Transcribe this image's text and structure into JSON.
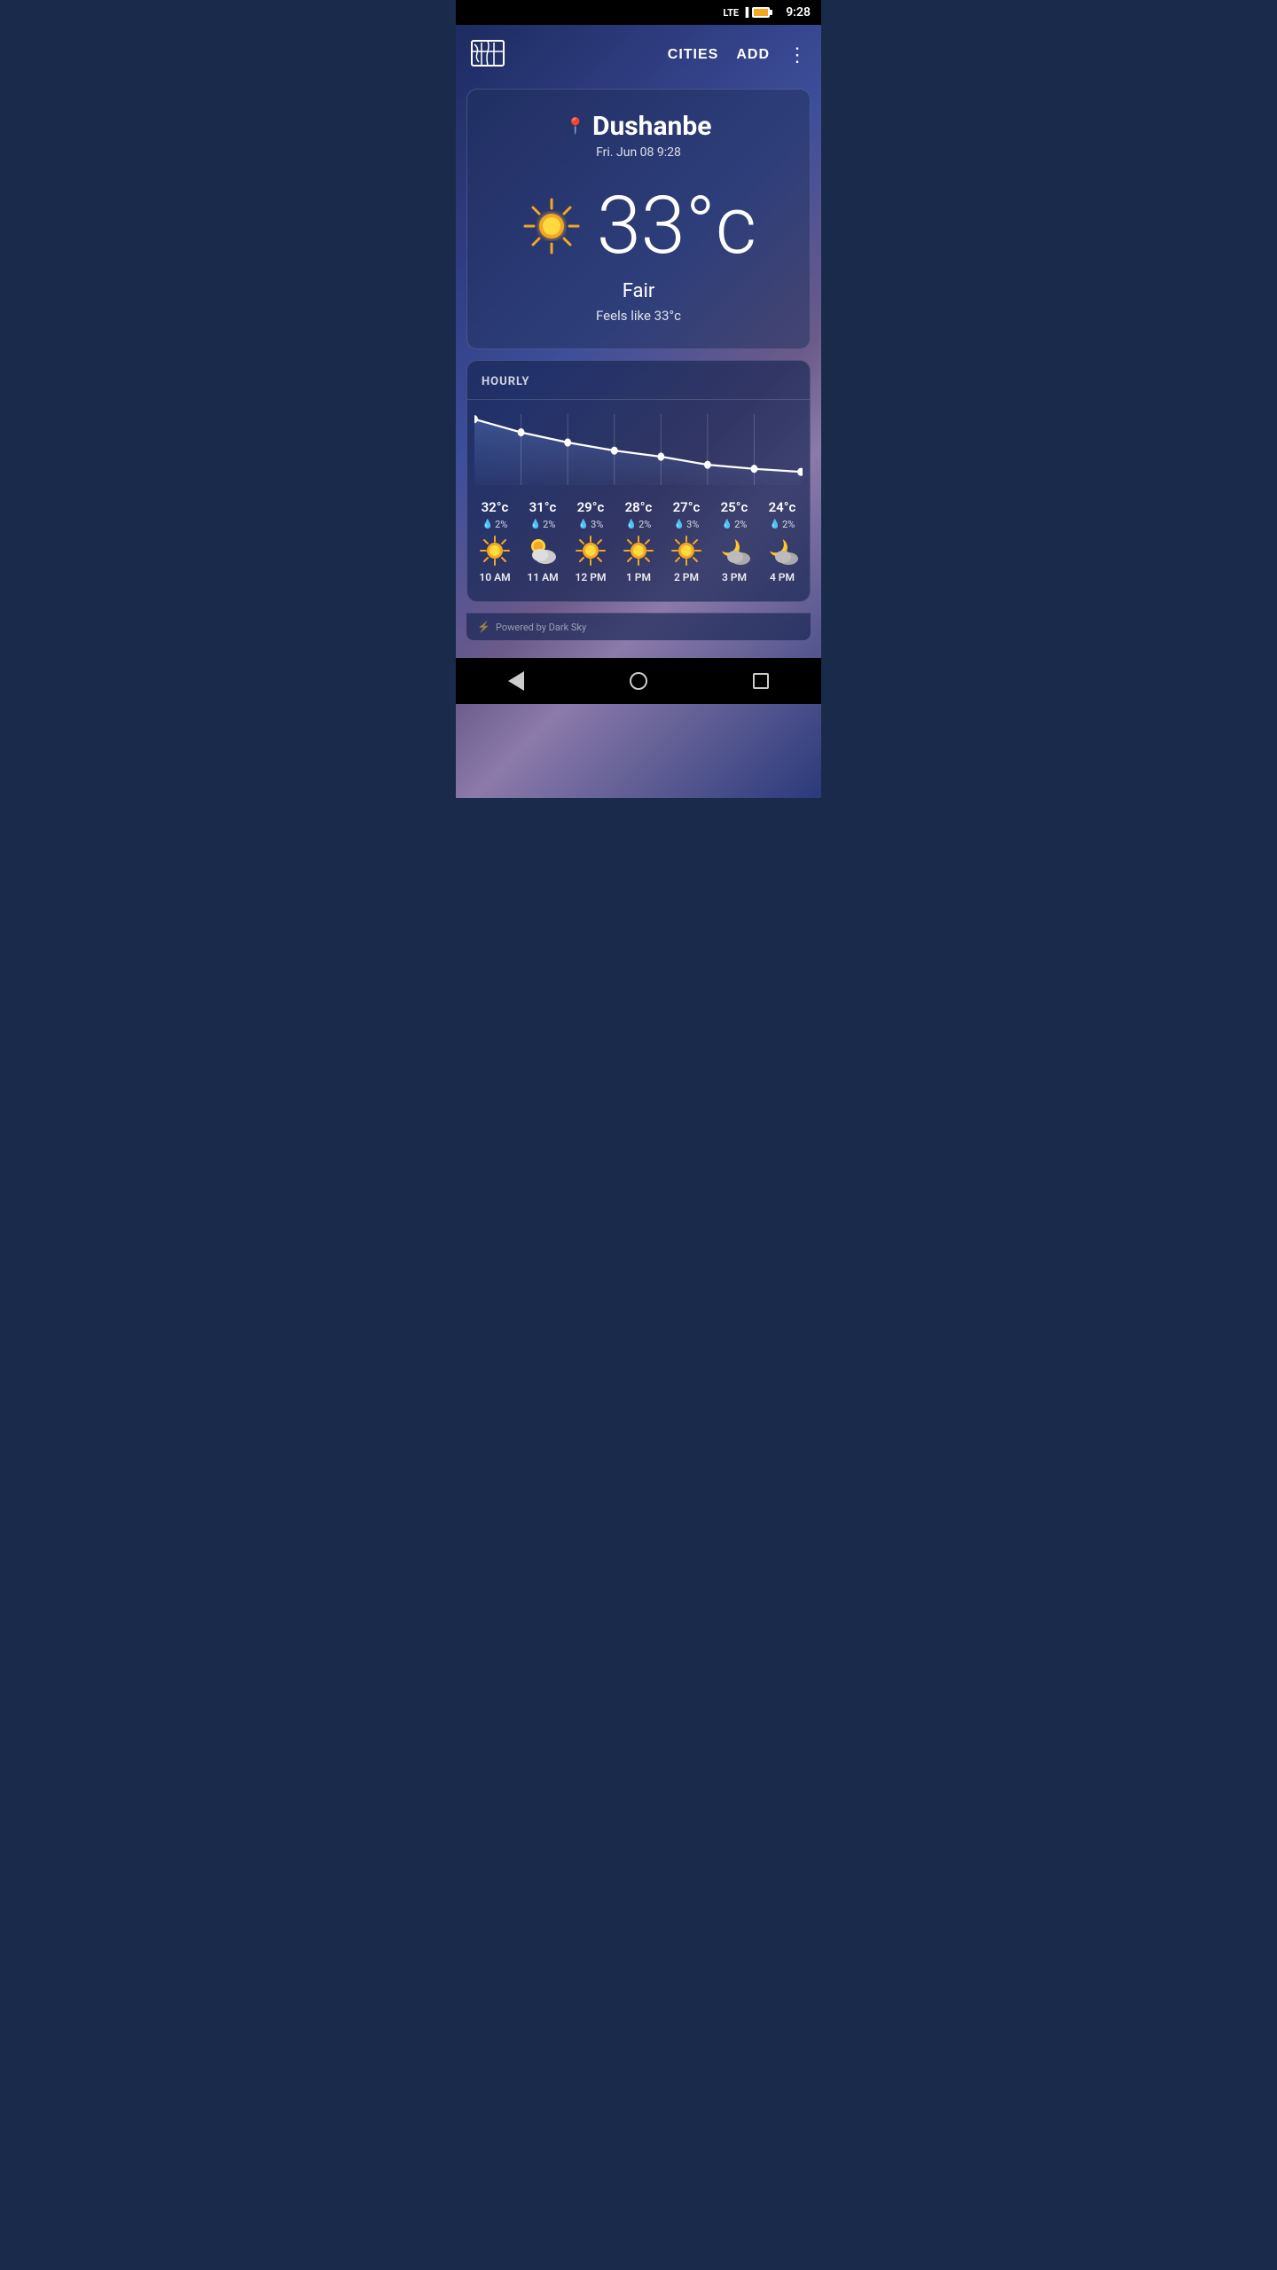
{
  "statusBar": {
    "time": "9:28",
    "signal": "LTE",
    "battery": "charging"
  },
  "header": {
    "citiesLabel": "CITIES",
    "addLabel": "ADD",
    "mapIconAlt": "map-icon"
  },
  "mainWeather": {
    "city": "Dushanbe",
    "datetime": "Fri. Jun 08 9:28",
    "temperature": "33°c",
    "condition": "Fair",
    "feelsLike": "Feels like 33°c"
  },
  "hourly": {
    "sectionLabel": "HOURLY",
    "items": [
      {
        "time": "10 AM",
        "temp": "32°c",
        "precip": "2%",
        "icon": "sun"
      },
      {
        "time": "11 AM",
        "temp": "31°c",
        "precip": "2%",
        "icon": "partly-cloudy"
      },
      {
        "time": "12 PM",
        "temp": "29°c",
        "precip": "3%",
        "icon": "sun"
      },
      {
        "time": "1 PM",
        "temp": "28°c",
        "precip": "2%",
        "icon": "sun"
      },
      {
        "time": "2 PM",
        "temp": "27°c",
        "precip": "3%",
        "icon": "sun"
      },
      {
        "time": "3 PM",
        "temp": "25°c",
        "precip": "2%",
        "icon": "night-cloudy"
      },
      {
        "time": "4 PM",
        "temp": "24°c",
        "precip": "2%",
        "icon": "night-cloudy"
      }
    ],
    "chartPoints": [
      0,
      14,
      25,
      34,
      42,
      52,
      58,
      62
    ],
    "poweredBy": "Powered by Dark Sky"
  },
  "navBar": {
    "backLabel": "back",
    "homeLabel": "home",
    "recentLabel": "recent"
  }
}
